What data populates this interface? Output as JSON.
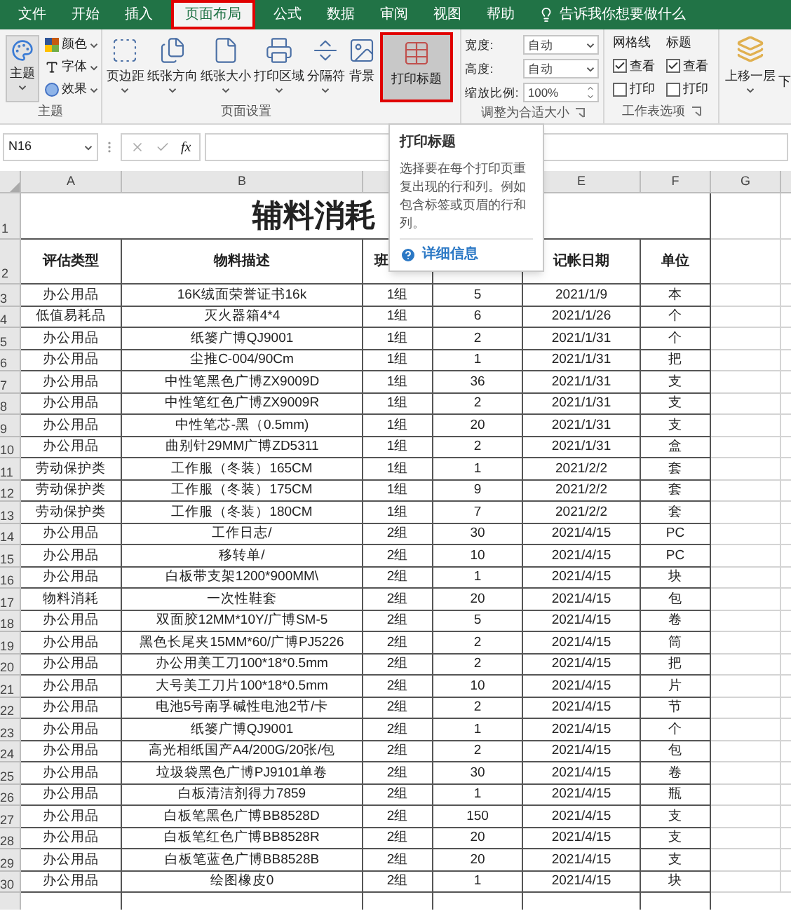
{
  "ribbon_tabs": [
    {
      "label": "文件",
      "selected": false
    },
    {
      "label": "开始",
      "selected": false
    },
    {
      "label": "插入",
      "selected": false
    },
    {
      "label": "页面布局",
      "selected": true
    },
    {
      "label": "公式",
      "selected": false
    },
    {
      "label": "数据",
      "selected": false
    },
    {
      "label": "审阅",
      "selected": false
    },
    {
      "label": "视图",
      "selected": false
    },
    {
      "label": "帮助",
      "selected": false
    }
  ],
  "tell_me": "告诉我你想要做什么",
  "theme_group": {
    "label": "主题",
    "button": "主题",
    "items": [
      "颜色",
      "字体",
      "效果"
    ]
  },
  "page_setup": {
    "label": "页面设置",
    "buttons": [
      {
        "label": "页边距",
        "has_menu": true,
        "selected": false
      },
      {
        "label": "纸张方向",
        "has_menu": true,
        "selected": false
      },
      {
        "label": "纸张大小",
        "has_menu": true,
        "selected": false
      },
      {
        "label": "打印区域",
        "has_menu": true,
        "selected": false
      },
      {
        "label": "分隔符",
        "has_menu": true,
        "selected": false
      },
      {
        "label": "背景",
        "has_menu": false,
        "selected": false
      },
      {
        "label": "打印标题",
        "has_menu": false,
        "selected": true
      }
    ]
  },
  "scale_group": {
    "label": "调整为合适大小",
    "fields": [
      {
        "kind": "dropdown",
        "label": "宽度:",
        "value": "自动"
      },
      {
        "kind": "dropdown",
        "label": "高度:",
        "value": "自动"
      },
      {
        "kind": "spinner",
        "label": "缩放比例:",
        "value": "100%"
      }
    ]
  },
  "sheet_options": {
    "label": "工作表选项",
    "columns": [
      {
        "title": "网格线",
        "options": [
          {
            "label": "查看",
            "checked": true
          },
          {
            "label": "打印",
            "checked": false
          }
        ]
      },
      {
        "title": "标题",
        "options": [
          {
            "label": "查看",
            "checked": true
          },
          {
            "label": "打印",
            "checked": false
          }
        ]
      }
    ]
  },
  "arrange": {
    "button": "上移一层",
    "next": "下"
  },
  "name_box": "N16",
  "function_symbol": "fx",
  "columns": {
    "left": [
      "A",
      "B"
    ],
    "right": [
      "E",
      "F",
      "G"
    ]
  },
  "title_row": {
    "number": "1",
    "title": "辅料消耗"
  },
  "header_row": {
    "number": "2",
    "left": [
      "评估类型",
      "物料描述",
      "班"
    ],
    "right": [
      "记帐日期",
      "单位"
    ]
  },
  "rows": [
    {
      "number": "3",
      "cells": [
        "办公用品",
        "16K绒面荣誉证书16k",
        "1组",
        "5",
        "2021/1/9",
        "本"
      ]
    },
    {
      "number": "4",
      "cells": [
        "低值易耗品",
        "灭火器箱4*4",
        "1组",
        "6",
        "2021/1/26",
        "个"
      ]
    },
    {
      "number": "5",
      "cells": [
        "办公用品",
        "纸篓广博QJ9001",
        "1组",
        "2",
        "2021/1/31",
        "个"
      ]
    },
    {
      "number": "6",
      "cells": [
        "办公用品",
        "尘推C-004/90Cm",
        "1组",
        "1",
        "2021/1/31",
        "把"
      ]
    },
    {
      "number": "7",
      "cells": [
        "办公用品",
        "中性笔黑色广博ZX9009D",
        "1组",
        "36",
        "2021/1/31",
        "支"
      ]
    },
    {
      "number": "8",
      "cells": [
        "办公用品",
        "中性笔红色广博ZX9009R",
        "1组",
        "2",
        "2021/1/31",
        "支"
      ]
    },
    {
      "number": "9",
      "cells": [
        "办公用品",
        "中性笔芯-黑（0.5mm)",
        "1组",
        "20",
        "2021/1/31",
        "支"
      ]
    },
    {
      "number": "10",
      "cells": [
        "办公用品",
        "曲别针29MM广博ZD5311",
        "1组",
        "2",
        "2021/1/31",
        "盒"
      ]
    },
    {
      "number": "11",
      "cells": [
        "劳动保护类",
        "工作服（冬装）165CM",
        "1组",
        "1",
        "2021/2/2",
        "套"
      ]
    },
    {
      "number": "12",
      "cells": [
        "劳动保护类",
        "工作服（冬装）175CM",
        "1组",
        "9",
        "2021/2/2",
        "套"
      ]
    },
    {
      "number": "13",
      "cells": [
        "劳动保护类",
        "工作服（冬装）180CM",
        "1组",
        "7",
        "2021/2/2",
        "套"
      ]
    },
    {
      "number": "14",
      "cells": [
        "办公用品",
        "工作日志/",
        "2组",
        "30",
        "2021/4/15",
        "PC"
      ]
    },
    {
      "number": "15",
      "cells": [
        "办公用品",
        "移转单/",
        "2组",
        "10",
        "2021/4/15",
        "PC"
      ]
    },
    {
      "number": "16",
      "cells": [
        "办公用品",
        "白板带支架1200*900MM\\",
        "2组",
        "1",
        "2021/4/15",
        "块"
      ]
    },
    {
      "number": "17",
      "cells": [
        "物料消耗",
        "一次性鞋套",
        "2组",
        "20",
        "2021/4/15",
        "包"
      ]
    },
    {
      "number": "18",
      "cells": [
        "办公用品",
        "双面胶12MM*10Y/广博SM-5",
        "2组",
        "5",
        "2021/4/15",
        "卷"
      ]
    },
    {
      "number": "19",
      "cells": [
        "办公用品",
        "黑色长尾夹15MM*60/广博PJ5226",
        "2组",
        "2",
        "2021/4/15",
        "筒"
      ]
    },
    {
      "number": "20",
      "cells": [
        "办公用品",
        "办公用美工刀100*18*0.5mm",
        "2组",
        "2",
        "2021/4/15",
        "把"
      ]
    },
    {
      "number": "21",
      "cells": [
        "办公用品",
        "大号美工刀片100*18*0.5mm",
        "2组",
        "10",
        "2021/4/15",
        "片"
      ]
    },
    {
      "number": "22",
      "cells": [
        "办公用品",
        "电池5号南孚碱性电池2节/卡",
        "2组",
        "2",
        "2021/4/15",
        "节"
      ]
    },
    {
      "number": "23",
      "cells": [
        "办公用品",
        "纸篓广博QJ9001",
        "2组",
        "1",
        "2021/4/15",
        "个"
      ]
    },
    {
      "number": "24",
      "cells": [
        "办公用品",
        "高光相纸国产A4/200G/20张/包",
        "2组",
        "2",
        "2021/4/15",
        "包"
      ]
    },
    {
      "number": "25",
      "cells": [
        "办公用品",
        "垃圾袋黑色广博PJ9101单卷",
        "2组",
        "30",
        "2021/4/15",
        "卷"
      ]
    },
    {
      "number": "26",
      "cells": [
        "办公用品",
        "白板清洁剂得力7859",
        "2组",
        "1",
        "2021/4/15",
        "瓶"
      ]
    },
    {
      "number": "27",
      "cells": [
        "办公用品",
        "白板笔黑色广博BB8528D",
        "2组",
        "150",
        "2021/4/15",
        "支"
      ]
    },
    {
      "number": "28",
      "cells": [
        "办公用品",
        "白板笔红色广博BB8528R",
        "2组",
        "20",
        "2021/4/15",
        "支"
      ]
    },
    {
      "number": "29",
      "cells": [
        "办公用品",
        "白板笔蓝色广博BB8528B",
        "2组",
        "20",
        "2021/4/15",
        "支"
      ]
    },
    {
      "number": "30",
      "cells": [
        "办公用品",
        "绘图橡皮0",
        "2组",
        "1",
        "2021/4/15",
        "块"
      ]
    }
  ],
  "tooltip": {
    "title": "打印标题",
    "body": "选择要在每个打印页重复出现的行和列。例如包含标签或页眉的行和列。",
    "link": "详细信息"
  }
}
